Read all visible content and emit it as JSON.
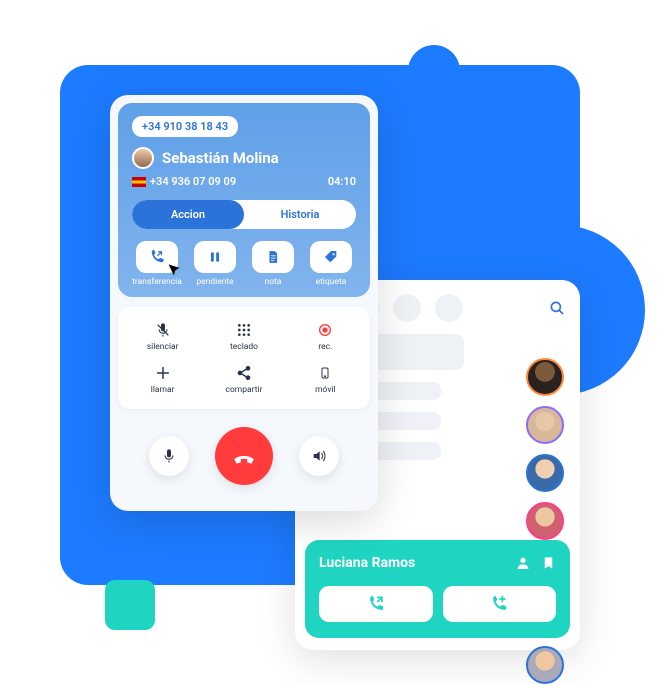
{
  "call": {
    "number_top": "+34 910 38 18 43",
    "name": "Sebastián Molina",
    "number_sub": "+34 936 07 09 09",
    "duration": "04:10"
  },
  "segments": {
    "action": "Accion",
    "history": "Historia"
  },
  "actions": {
    "transfer": "transferencia",
    "hold": "pendiente",
    "note": "nota",
    "tag": "etiqueta"
  },
  "controls": {
    "mute": "silenciar",
    "keypad": "teclado",
    "rec": "rec.",
    "call": "llamar",
    "share": "compartir",
    "mobile": "móvil"
  },
  "transfer_card": {
    "name": "Luciana Ramos"
  },
  "colors": {
    "accent_blue": "#1d7bff",
    "accent_teal": "#1fd4c0",
    "hangup_red": "#ff3b3b"
  }
}
